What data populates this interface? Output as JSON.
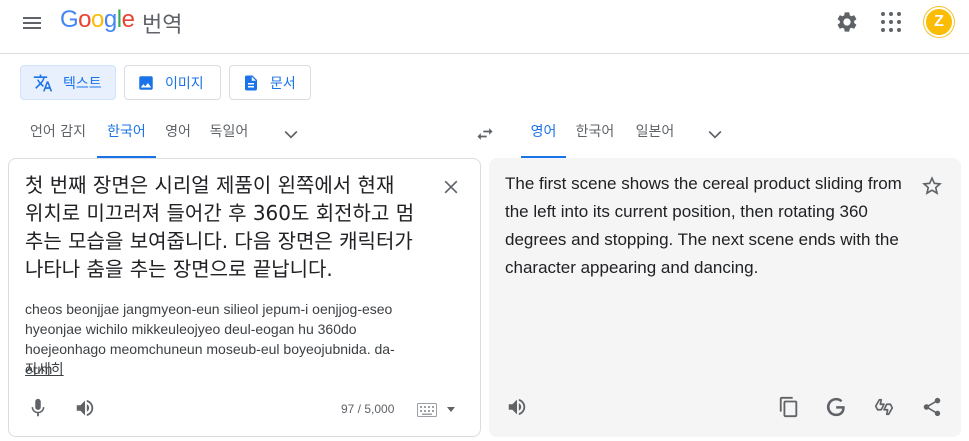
{
  "header": {
    "logo_letters": [
      "G",
      "o",
      "o",
      "g",
      "l",
      "e"
    ],
    "product": "번역",
    "avatar_letter": "Z"
  },
  "modes": [
    {
      "label": "텍스트",
      "icon": "translate-icon"
    },
    {
      "label": "이미지",
      "icon": "image-icon"
    },
    {
      "label": "문서",
      "icon": "document-icon"
    }
  ],
  "source_langs": [
    "언어 감지",
    "한국어",
    "영어",
    "독일어"
  ],
  "target_langs": [
    "영어",
    "한국어",
    "일본어"
  ],
  "source": {
    "text": "첫 번째 장면은 시리얼 제품이 왼쪽에서 현재 위치로 미끄러져 들어간 후 360도 회전하고 멈추는 모습을 보여줍니다. 다음 장면은 캐릭터가 나타나 춤을 추는 장면으로 끝납니다.",
    "romanization": "cheos beonjjae jangmyeon-eun silieol jepum-i oenjjog-eseo hyeonjae wichilo mikkeuleojyeo deul-eogan hu 360do hoejeonhago meomchuneun moseub-eul boyeojubnida. da-eum",
    "more_link": "자세히",
    "char_count": "97 / 5,000"
  },
  "target": {
    "text": "The first scene shows the cereal product sliding from the left into its current position, then rotating 360 degrees and stopping. The next scene ends with the character appearing and dancing."
  },
  "colors": {
    "accent": "#1a73e8",
    "active_bg": "#e8f0fe",
    "target_bg": "#f5f5f5",
    "icon_grey": "#5f6368"
  }
}
